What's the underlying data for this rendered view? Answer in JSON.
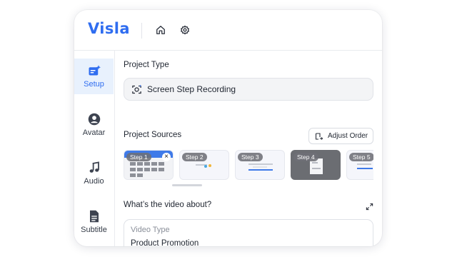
{
  "app": {
    "logo": "Visla"
  },
  "topbar": {
    "icons": [
      "home-icon",
      "settings-gear-icon"
    ]
  },
  "sidebar": {
    "items": [
      {
        "label": "Setup",
        "icon": "document-sparkle-icon",
        "active": true
      },
      {
        "label": "Avatar",
        "icon": "person-icon",
        "active": false
      },
      {
        "label": "Audio",
        "icon": "music-note-icon",
        "active": false
      },
      {
        "label": "Subtitle",
        "icon": "document-icon",
        "active": false
      }
    ]
  },
  "project_type": {
    "heading": "Project Type",
    "value": "Screen Step Recording",
    "icon": "screen-record-sparkle-icon"
  },
  "project_sources": {
    "heading": "Project Sources",
    "adjust_button": "Adjust Order",
    "steps": [
      {
        "label": "Step 1",
        "has_close": true
      },
      {
        "label": "Step 2"
      },
      {
        "label": "Step 3"
      },
      {
        "label": "Step 4"
      },
      {
        "label": "Step 5"
      }
    ]
  },
  "video_about": {
    "heading": "What’s the video about?",
    "field_placeholder": "Video Type",
    "field_value": "Product Promotion"
  },
  "colors": {
    "accent": "#2f6df0",
    "active_bg": "#e8f1fd"
  }
}
